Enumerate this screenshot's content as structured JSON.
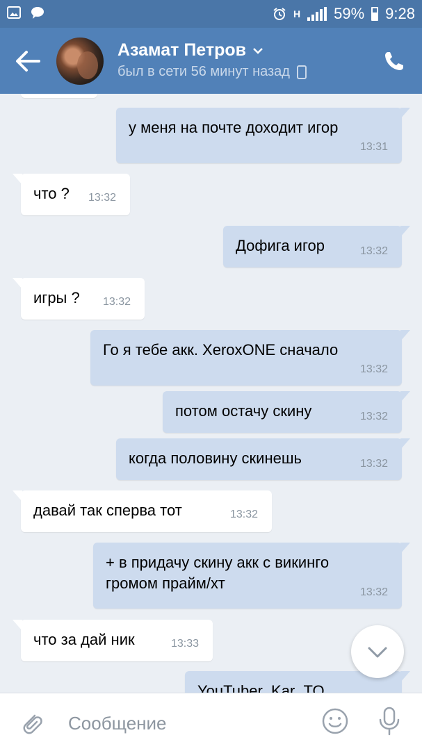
{
  "status_bar": {
    "battery": "59%",
    "time": "9:28",
    "network": "H"
  },
  "header": {
    "name": "Азамат Петров",
    "status": "был в сети 56 минут назад"
  },
  "messages": [
    {
      "dir": "out",
      "text": "у меня на почте доходит игор",
      "time": "13:31"
    },
    {
      "dir": "in",
      "text": "что ?",
      "time": "13:32"
    },
    {
      "dir": "out",
      "text": "Дофига игор",
      "time": "13:32"
    },
    {
      "dir": "in",
      "text": "игры ?",
      "time": "13:32"
    },
    {
      "dir": "out",
      "text": "Го я тебе акк. XeroxONE сначало",
      "time": "13:32"
    },
    {
      "dir": "out",
      "text": "потом остачу скину",
      "time": "13:32"
    },
    {
      "dir": "out",
      "text": "когда половину скинешь",
      "time": "13:32"
    },
    {
      "dir": "in",
      "text": "давай так сперва тот",
      "time": "13:32"
    },
    {
      "dir": "out",
      "text": "+ в придачу скину акк с викинго громом прайм/хт",
      "time": "13:32"
    },
    {
      "dir": "in",
      "text": "что за дай ник",
      "time": "13:33"
    },
    {
      "dir": "out",
      "text": "YouTuber_Kar_TO",
      "time": ""
    }
  ],
  "composer": {
    "placeholder": "Сообщение"
  },
  "icons": {
    "back": "arrow-left-icon",
    "call": "phone-icon",
    "attach": "paperclip-icon",
    "emoji": "smiley-icon",
    "mic": "microphone-icon",
    "scroll": "chevron-down-icon"
  },
  "colors": {
    "header": "#5181b8",
    "status_bar": "#4a76a8",
    "background": "#ebeff4",
    "outgoing_bubble": "#cddbee",
    "incoming_bubble": "#ffffff"
  }
}
